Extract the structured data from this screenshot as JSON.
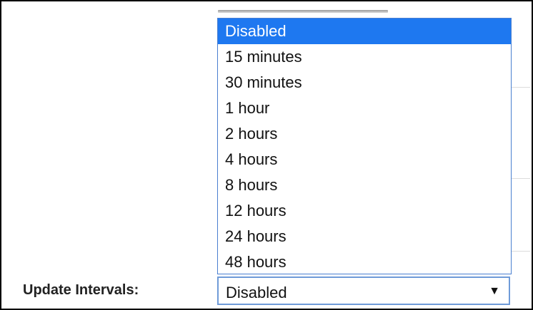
{
  "field": {
    "label": "Update Intervals:",
    "selected_value": "Disabled"
  },
  "dropdown": {
    "selected_index": 0,
    "options": [
      "Disabled",
      "15 minutes",
      "30 minutes",
      "1 hour",
      "2 hours",
      "4 hours",
      "8 hours",
      "12 hours",
      "24 hours",
      "48 hours"
    ]
  },
  "icons": {
    "select_arrow": "▼"
  },
  "colors": {
    "highlight": "#1e78f0",
    "select_border": "#6f9bd8"
  }
}
